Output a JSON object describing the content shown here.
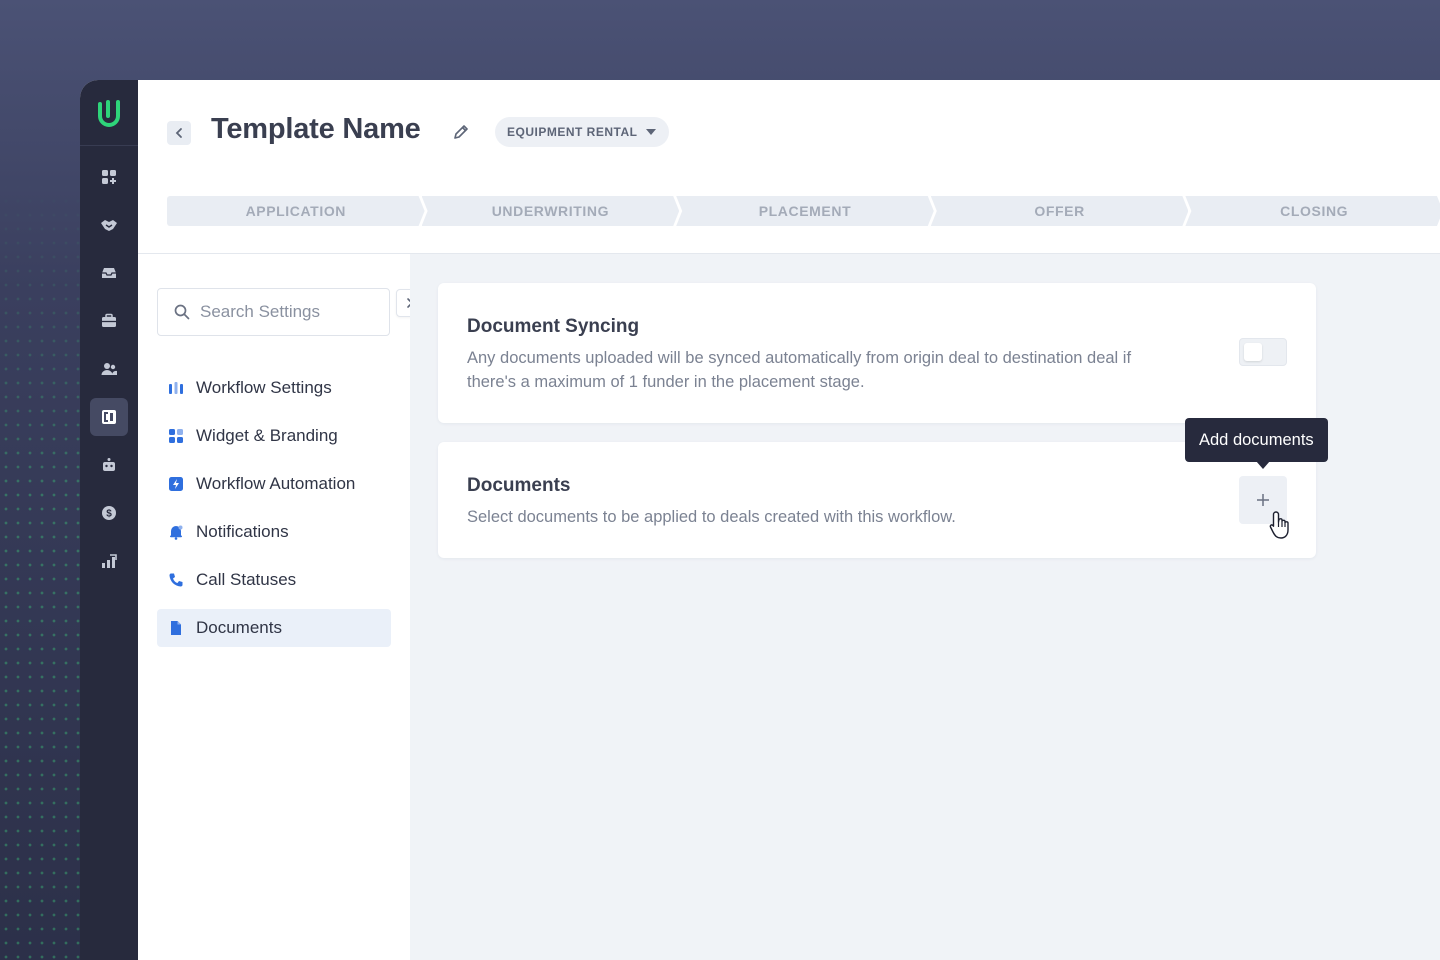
{
  "header": {
    "title": "Template Name",
    "type_pill": "EQUIPMENT RENTAL",
    "stages": [
      "APPLICATION",
      "UNDERWRITING",
      "PLACEMENT",
      "OFFER",
      "CLOSING"
    ]
  },
  "sidebar_rail": {
    "items": [
      "dashboard-icon",
      "deals-icon",
      "inbox-icon",
      "briefcase-icon",
      "contacts-icon",
      "workflows-icon",
      "bot-icon",
      "billing-icon",
      "analytics-icon"
    ],
    "active_index": 5
  },
  "settings": {
    "search_placeholder": "Search Settings",
    "items": [
      {
        "label": "Workflow Settings",
        "icon": "workflow-settings-icon"
      },
      {
        "label": "Widget & Branding",
        "icon": "widget-icon"
      },
      {
        "label": "Workflow Automation",
        "icon": "automation-icon"
      },
      {
        "label": "Notifications",
        "icon": "bell-icon"
      },
      {
        "label": "Call Statuses",
        "icon": "phone-icon"
      },
      {
        "label": "Documents",
        "icon": "document-icon"
      }
    ],
    "active": "Documents"
  },
  "cards": {
    "syncing": {
      "title": "Document Syncing",
      "description": "Any documents uploaded will be synced automatically from origin deal to destination deal if there's a maximum of 1 funder in the placement stage.",
      "toggle_on": false
    },
    "documents": {
      "title": "Documents",
      "description": "Select documents to be applied to deals created with this workflow.",
      "add_tooltip": "Add documents"
    }
  },
  "colors": {
    "brand": "#2ed47a",
    "accent": "#2f6fde",
    "rail": "#272a3d"
  }
}
